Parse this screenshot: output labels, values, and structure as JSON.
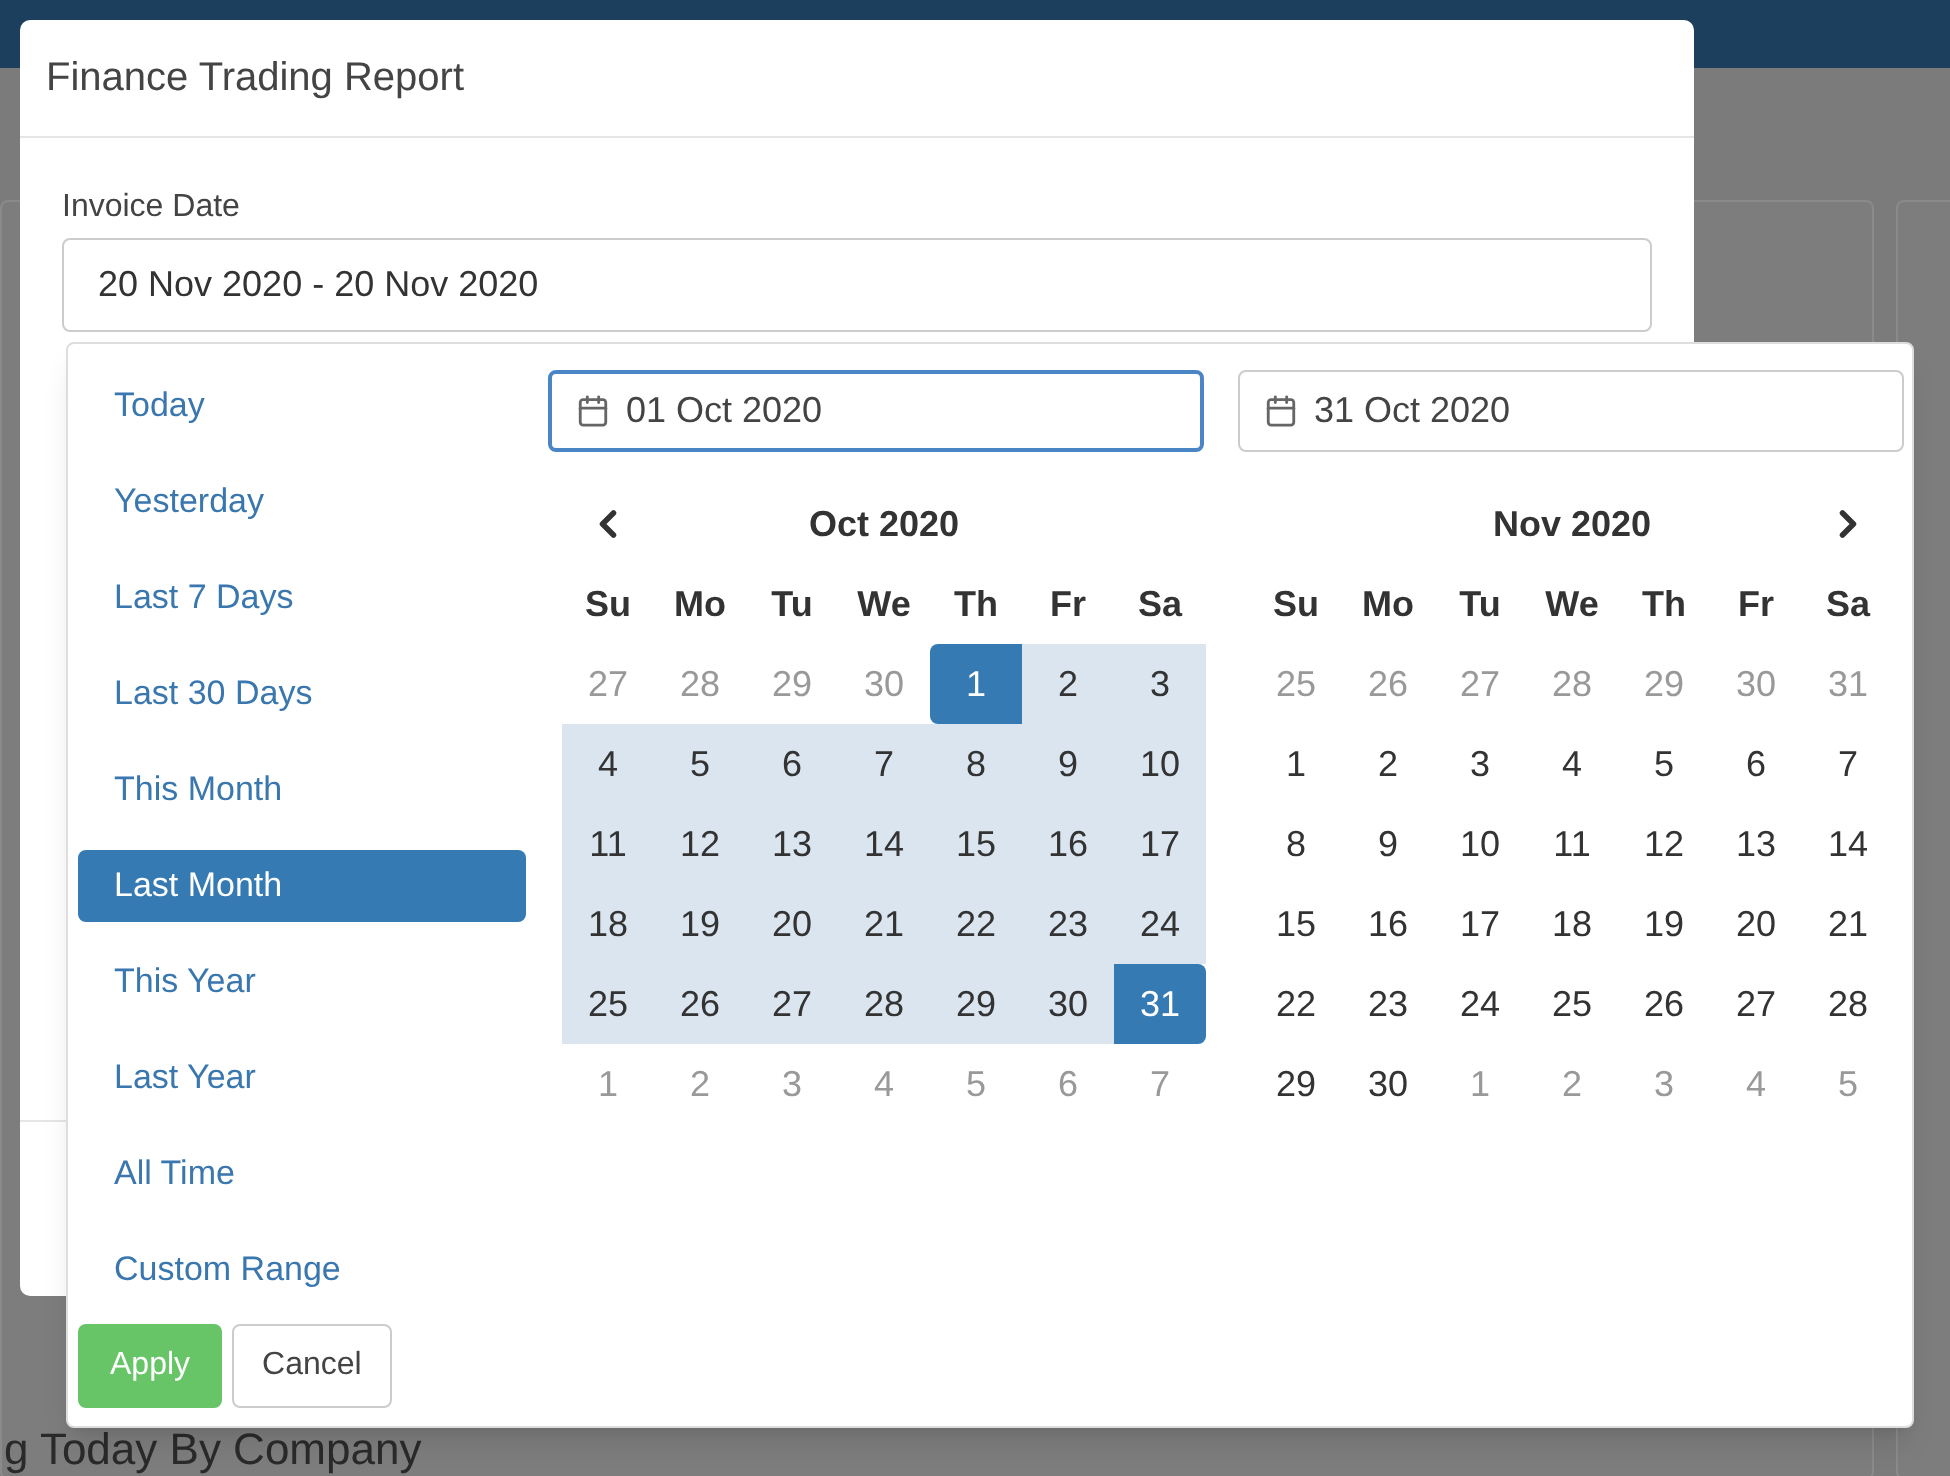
{
  "modal": {
    "title": "Finance Trading Report",
    "field_label": "Invoice Date",
    "field_value": "20 Nov 2020 - 20 Nov 2020"
  },
  "background": {
    "heading": "g Today By Company"
  },
  "date_picker": {
    "ranges": [
      {
        "label": "Today",
        "selected": false
      },
      {
        "label": "Yesterday",
        "selected": false
      },
      {
        "label": "Last 7 Days",
        "selected": false
      },
      {
        "label": "Last 30 Days",
        "selected": false
      },
      {
        "label": "This Month",
        "selected": false
      },
      {
        "label": "Last Month",
        "selected": true
      },
      {
        "label": "This Year",
        "selected": false
      },
      {
        "label": "Last Year",
        "selected": false
      },
      {
        "label": "All Time",
        "selected": false
      },
      {
        "label": "Custom Range",
        "selected": false
      }
    ],
    "buttons": [
      {
        "label": "Apply",
        "kind": "primary"
      },
      {
        "label": "Cancel",
        "kind": "secondary"
      }
    ],
    "calendars": [
      {
        "input": "01 Oct 2020",
        "focused": true,
        "title": "Oct 2020",
        "prev_arrow": true,
        "next_arrow": false,
        "weekdays": [
          "Su",
          "Mo",
          "Tu",
          "We",
          "Th",
          "Fr",
          "Sa"
        ],
        "weeks": [
          [
            {
              "label": "27",
              "kind": "off"
            },
            {
              "label": "28",
              "kind": "off"
            },
            {
              "label": "29",
              "kind": "off"
            },
            {
              "label": "30",
              "kind": "off"
            },
            {
              "label": "1",
              "kind": "start"
            },
            {
              "label": "2",
              "kind": "in_range"
            },
            {
              "label": "3",
              "kind": "in_range"
            }
          ],
          [
            {
              "label": "4",
              "kind": "in_range"
            },
            {
              "label": "5",
              "kind": "in_range"
            },
            {
              "label": "6",
              "kind": "in_range"
            },
            {
              "label": "7",
              "kind": "in_range"
            },
            {
              "label": "8",
              "kind": "in_range"
            },
            {
              "label": "9",
              "kind": "in_range"
            },
            {
              "label": "10",
              "kind": "in_range"
            }
          ],
          [
            {
              "label": "11",
              "kind": "in_range"
            },
            {
              "label": "12",
              "kind": "in_range"
            },
            {
              "label": "13",
              "kind": "in_range"
            },
            {
              "label": "14",
              "kind": "in_range"
            },
            {
              "label": "15",
              "kind": "in_range"
            },
            {
              "label": "16",
              "kind": "in_range"
            },
            {
              "label": "17",
              "kind": "in_range"
            }
          ],
          [
            {
              "label": "18",
              "kind": "in_range"
            },
            {
              "label": "19",
              "kind": "in_range"
            },
            {
              "label": "20",
              "kind": "in_range"
            },
            {
              "label": "21",
              "kind": "in_range"
            },
            {
              "label": "22",
              "kind": "in_range"
            },
            {
              "label": "23",
              "kind": "in_range"
            },
            {
              "label": "24",
              "kind": "in_range"
            }
          ],
          [
            {
              "label": "25",
              "kind": "in_range"
            },
            {
              "label": "26",
              "kind": "in_range"
            },
            {
              "label": "27",
              "kind": "in_range"
            },
            {
              "label": "28",
              "kind": "in_range"
            },
            {
              "label": "29",
              "kind": "in_range"
            },
            {
              "label": "30",
              "kind": "in_range"
            },
            {
              "label": "31",
              "kind": "end"
            }
          ],
          [
            {
              "label": "1",
              "kind": "off"
            },
            {
              "label": "2",
              "kind": "off"
            },
            {
              "label": "3",
              "kind": "off"
            },
            {
              "label": "4",
              "kind": "off"
            },
            {
              "label": "5",
              "kind": "off"
            },
            {
              "label": "6",
              "kind": "off"
            },
            {
              "label": "7",
              "kind": "off"
            }
          ]
        ]
      },
      {
        "input": "31 Oct 2020",
        "focused": false,
        "title": "Nov 2020",
        "prev_arrow": false,
        "next_arrow": true,
        "weekdays": [
          "Su",
          "Mo",
          "Tu",
          "We",
          "Th",
          "Fr",
          "Sa"
        ],
        "weeks": [
          [
            {
              "label": "25",
              "kind": "off"
            },
            {
              "label": "26",
              "kind": "off"
            },
            {
              "label": "27",
              "kind": "off"
            },
            {
              "label": "28",
              "kind": "off"
            },
            {
              "label": "29",
              "kind": "off"
            },
            {
              "label": "30",
              "kind": "off"
            },
            {
              "label": "31",
              "kind": "off"
            }
          ],
          [
            {
              "label": "1",
              "kind": "normal"
            },
            {
              "label": "2",
              "kind": "normal"
            },
            {
              "label": "3",
              "kind": "normal"
            },
            {
              "label": "4",
              "kind": "normal"
            },
            {
              "label": "5",
              "kind": "normal"
            },
            {
              "label": "6",
              "kind": "normal"
            },
            {
              "label": "7",
              "kind": "normal"
            }
          ],
          [
            {
              "label": "8",
              "kind": "normal"
            },
            {
              "label": "9",
              "kind": "normal"
            },
            {
              "label": "10",
              "kind": "normal"
            },
            {
              "label": "11",
              "kind": "normal"
            },
            {
              "label": "12",
              "kind": "normal"
            },
            {
              "label": "13",
              "kind": "normal"
            },
            {
              "label": "14",
              "kind": "normal"
            }
          ],
          [
            {
              "label": "15",
              "kind": "normal"
            },
            {
              "label": "16",
              "kind": "normal"
            },
            {
              "label": "17",
              "kind": "normal"
            },
            {
              "label": "18",
              "kind": "normal"
            },
            {
              "label": "19",
              "kind": "normal"
            },
            {
              "label": "20",
              "kind": "normal"
            },
            {
              "label": "21",
              "kind": "normal"
            }
          ],
          [
            {
              "label": "22",
              "kind": "normal"
            },
            {
              "label": "23",
              "kind": "normal"
            },
            {
              "label": "24",
              "kind": "normal"
            },
            {
              "label": "25",
              "kind": "normal"
            },
            {
              "label": "26",
              "kind": "normal"
            },
            {
              "label": "27",
              "kind": "normal"
            },
            {
              "label": "28",
              "kind": "normal"
            }
          ],
          [
            {
              "label": "29",
              "kind": "normal"
            },
            {
              "label": "30",
              "kind": "normal"
            },
            {
              "label": "1",
              "kind": "off"
            },
            {
              "label": "2",
              "kind": "off"
            },
            {
              "label": "3",
              "kind": "off"
            },
            {
              "label": "4",
              "kind": "off"
            },
            {
              "label": "5",
              "kind": "off"
            }
          ]
        ]
      }
    ]
  }
}
